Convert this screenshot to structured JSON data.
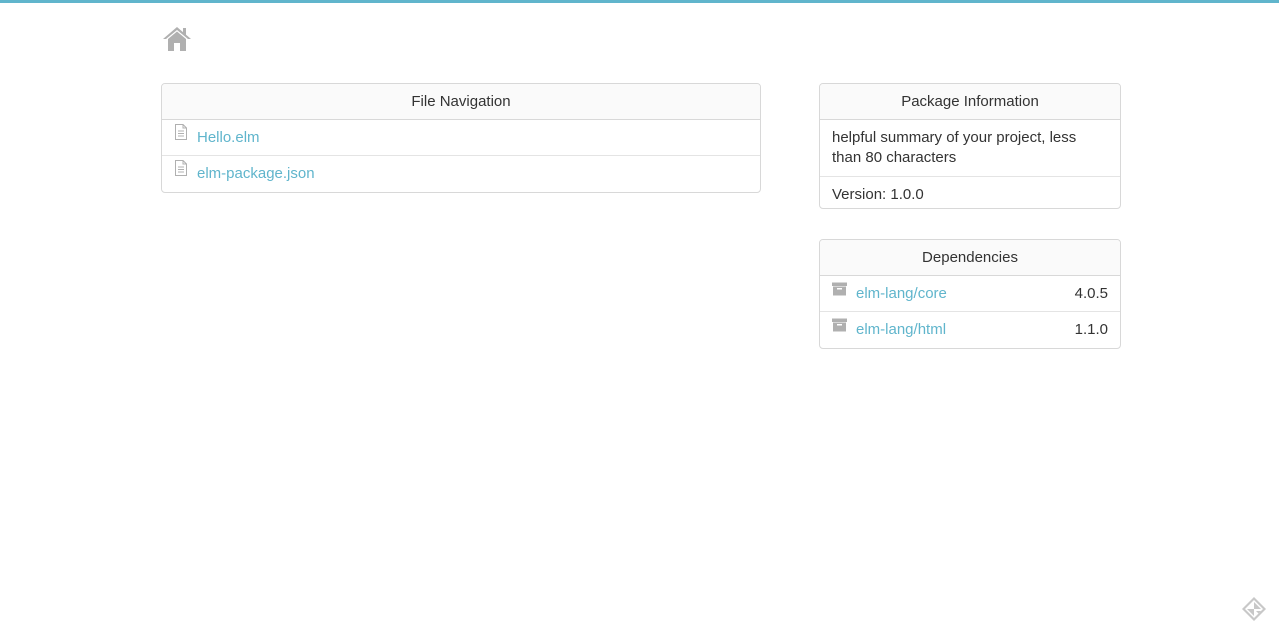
{
  "header": {
    "home_icon": "home-icon"
  },
  "file_navigation": {
    "title": "File Navigation",
    "files": [
      {
        "name": "Hello.elm",
        "icon": "file-icon"
      },
      {
        "name": "elm-package.json",
        "icon": "file-icon"
      }
    ]
  },
  "package_information": {
    "title": "Package Information",
    "summary": "helpful summary of your project, less than 80 characters",
    "version": "Version: 1.0.0"
  },
  "dependencies": {
    "title": "Dependencies",
    "items": [
      {
        "name": "elm-lang/core",
        "version": "4.0.5",
        "icon": "package-icon"
      },
      {
        "name": "elm-lang/html",
        "version": "1.1.0",
        "icon": "package-icon"
      }
    ]
  },
  "colors": {
    "accent": "#60b5cc",
    "icon_gray": "#b0b0b0",
    "border": "#d8d8d8"
  }
}
